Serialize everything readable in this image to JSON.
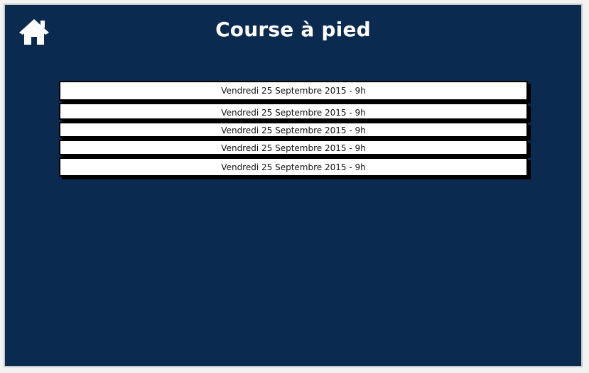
{
  "header": {
    "title": "Course à pied",
    "home_icon": "home-icon"
  },
  "sessions": [
    {
      "label": "Vendredi 25 Septembre 2015 - 9h"
    },
    {
      "label": "Vendredi 25 Septembre 2015 - 9h"
    },
    {
      "label": "Vendredi 25 Septembre 2015 - 9h"
    },
    {
      "label": "Vendredi 25 Septembre 2015 - 9h"
    },
    {
      "label": "Vendredi 25 Septembre 2015 - 9h"
    }
  ],
  "colors": {
    "background": "#0b2a4f",
    "row_background": "#ffffff",
    "row_border": "#000000",
    "title_color": "#ffffff"
  }
}
